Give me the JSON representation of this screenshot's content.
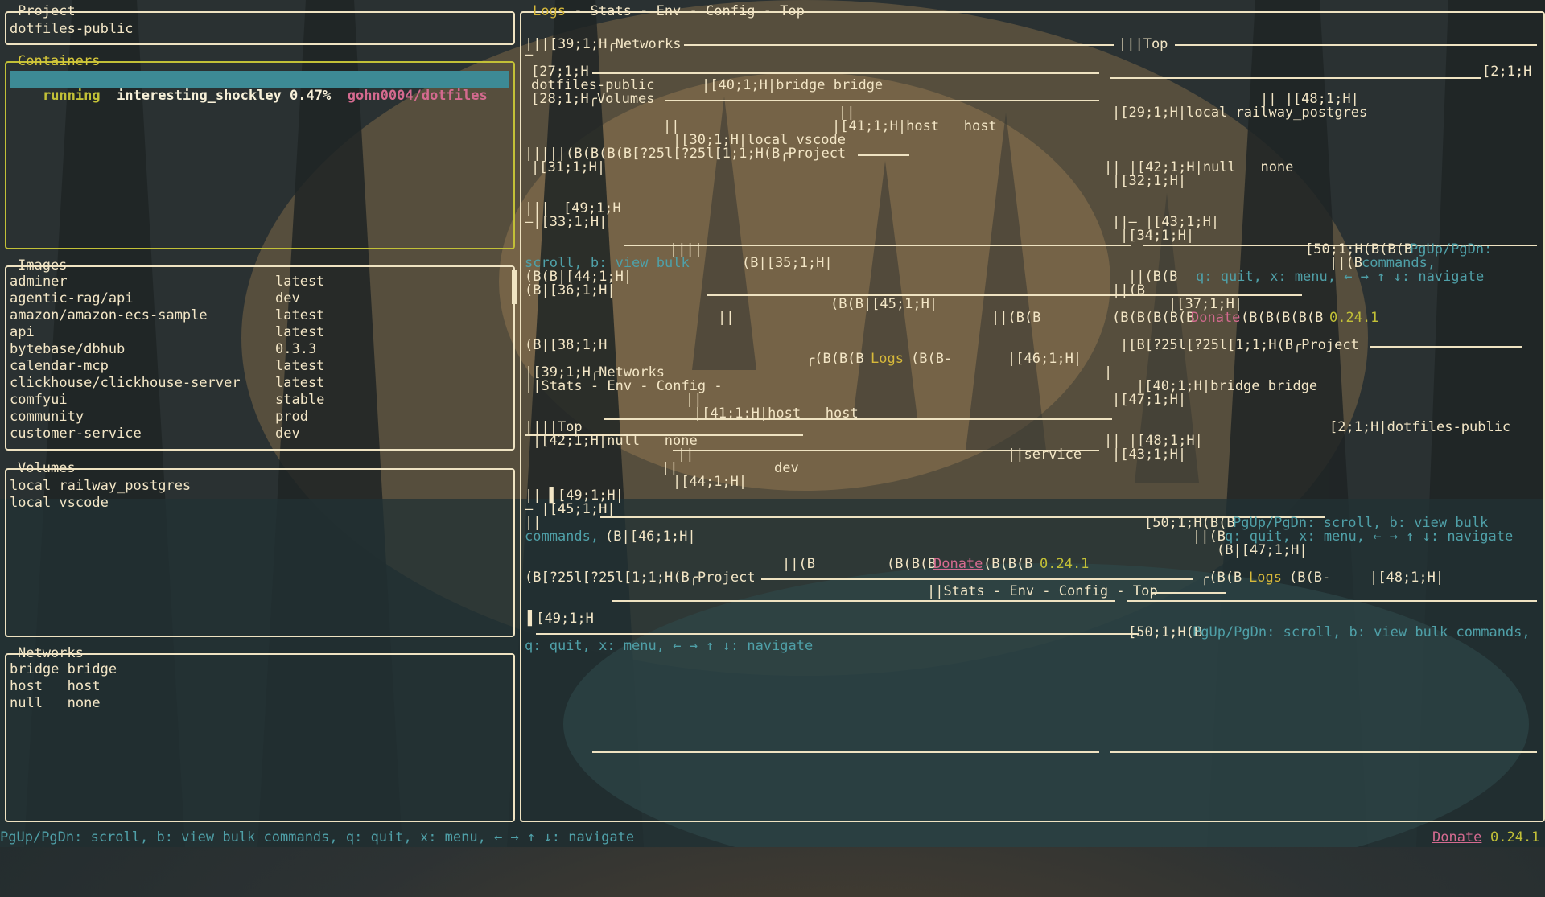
{
  "project": {
    "title": "Project",
    "name": "dotfiles-public"
  },
  "containers": {
    "title": "Containers",
    "items": [
      {
        "status": "running",
        "name": "interesting_shockley",
        "cpu": "0.47%",
        "image": "gohn0004/dotfiles"
      }
    ]
  },
  "images": {
    "title": "Images",
    "items": [
      {
        "name": "adminer",
        "tag": "latest"
      },
      {
        "name": "agentic-rag/api",
        "tag": "dev"
      },
      {
        "name": "amazon/amazon-ecs-sample",
        "tag": "latest"
      },
      {
        "name": "api",
        "tag": "latest"
      },
      {
        "name": "bytebase/dbhub",
        "tag": "0.3.3"
      },
      {
        "name": "calendar-mcp",
        "tag": "latest"
      },
      {
        "name": "clickhouse/clickhouse-server",
        "tag": "latest"
      },
      {
        "name": "comfyui",
        "tag": "stable"
      },
      {
        "name": "community",
        "tag": "prod"
      },
      {
        "name": "customer-service",
        "tag": "dev"
      }
    ]
  },
  "volumes": {
    "title": "Volumes",
    "items": [
      "local railway_postgres",
      "local vscode"
    ]
  },
  "networks": {
    "title": "Networks",
    "items": [
      "bridge bridge",
      "host   host",
      "null   none"
    ]
  },
  "main_tabs": [
    "Logs",
    "Stats",
    "Env",
    "Config",
    "Top"
  ],
  "tab_sep": " - ",
  "garbled": [
    "|||[39;1;H╭Networks",
    "|||Top",
    "[27;1;H",
    "[2;1;H",
    "dotfiles-public",
    "|[40;1;H|bridge bridge",
    "[28;1;H╭Volumes",
    "|| |[48;1;H|",
    "|[29;1;H|local railway_postgres",
    "||",
    "|[41;1;H|host   host",
    "||",
    "|[30;1;H|local vscode",
    "|||||(B(B(B(B[?25l[?25l[1;1;H(B╭Project",
    "|[31;1;H|",
    "|| |[42;1;H|null   none",
    "|[32;1;H|",
    "|||",
    "[49;1;H",
    "—|[33;1;H|",
    "||— |[43;1;H|",
    "|[34;1;H|",
    "||||",
    "[50;1;H(B(B(B",
    "PgUp/PgDn:",
    "scroll, b: view bulk",
    "(B|[35;1;H|",
    "||(B",
    "commands,",
    "(B(B|[44;1;H|",
    "||(B(B",
    "q: quit, x: menu, ← → ↑ ↓: navigate",
    "(B|[36;1;H|",
    "||(B",
    "|[37;1;H|",
    "(B(B|[45;1;H|",
    "||",
    "||(B(B",
    "(B(B(B(B(B",
    "Donate",
    "(B(B(B(B(B",
    "0.24.1",
    "(B|[38;1;H",
    "|[B[?25l[?25l[1;1;H(B╭Project",
    "╭(B(B(B",
    "Logs",
    "(B(B-",
    "|[46;1;H|",
    "|[39;1;H╭Networks",
    "|",
    "||Stats - Env - Config -",
    "|[40;1;H|bridge bridge",
    "||",
    "|[47;1;H|",
    "|[41;1;H|host   host",
    "||||Top",
    "[2;1;H|dotfiles-public",
    "|[42;1;H|null   none",
    "|| |[48;1;H|",
    "||",
    "||service",
    "|[43;1;H|",
    "||",
    "dev",
    "|[44;1;H|",
    "|| ▌[49;1;H|",
    "— |[45;1;H|",
    "||",
    "[50;1;H(B(B",
    "PgUp/PgDn: scroll, b: view bulk",
    "commands,",
    "(B|[46;1;H|",
    "||(B",
    "q: quit, x: menu, ← → ↑ ↓: navigate",
    "(B|[47;1;H|",
    "||(B",
    "(B(B(B",
    "Donate",
    "(B(B(B",
    "0.24.1",
    "(B[?25l[?25l[1;1;H(B╭Project",
    "╭(B(B",
    "Logs",
    "(B(B-",
    "|[48;1;H|",
    "||Stats - Env - Config - Top",
    "▌[49;1;H",
    "[50;1;H(B",
    "PgUp/PgDn: scroll, b: view bulk commands,",
    "q: quit, x: menu, ← → ↑ ↓: navigate",
    "—"
  ],
  "status_bar": {
    "hints": "PgUp/PgDn: scroll, b: view bulk commands, q: quit, x: menu, ← → ↑ ↓: navigate",
    "donate": "Donate",
    "version": "0.24.1"
  },
  "colors": {
    "border": "#efe3c2",
    "focus": "#c2c037",
    "selected_bg": "#3d8a95",
    "accent_pink": "#d46a8f",
    "hint": "#4fa0a8"
  }
}
